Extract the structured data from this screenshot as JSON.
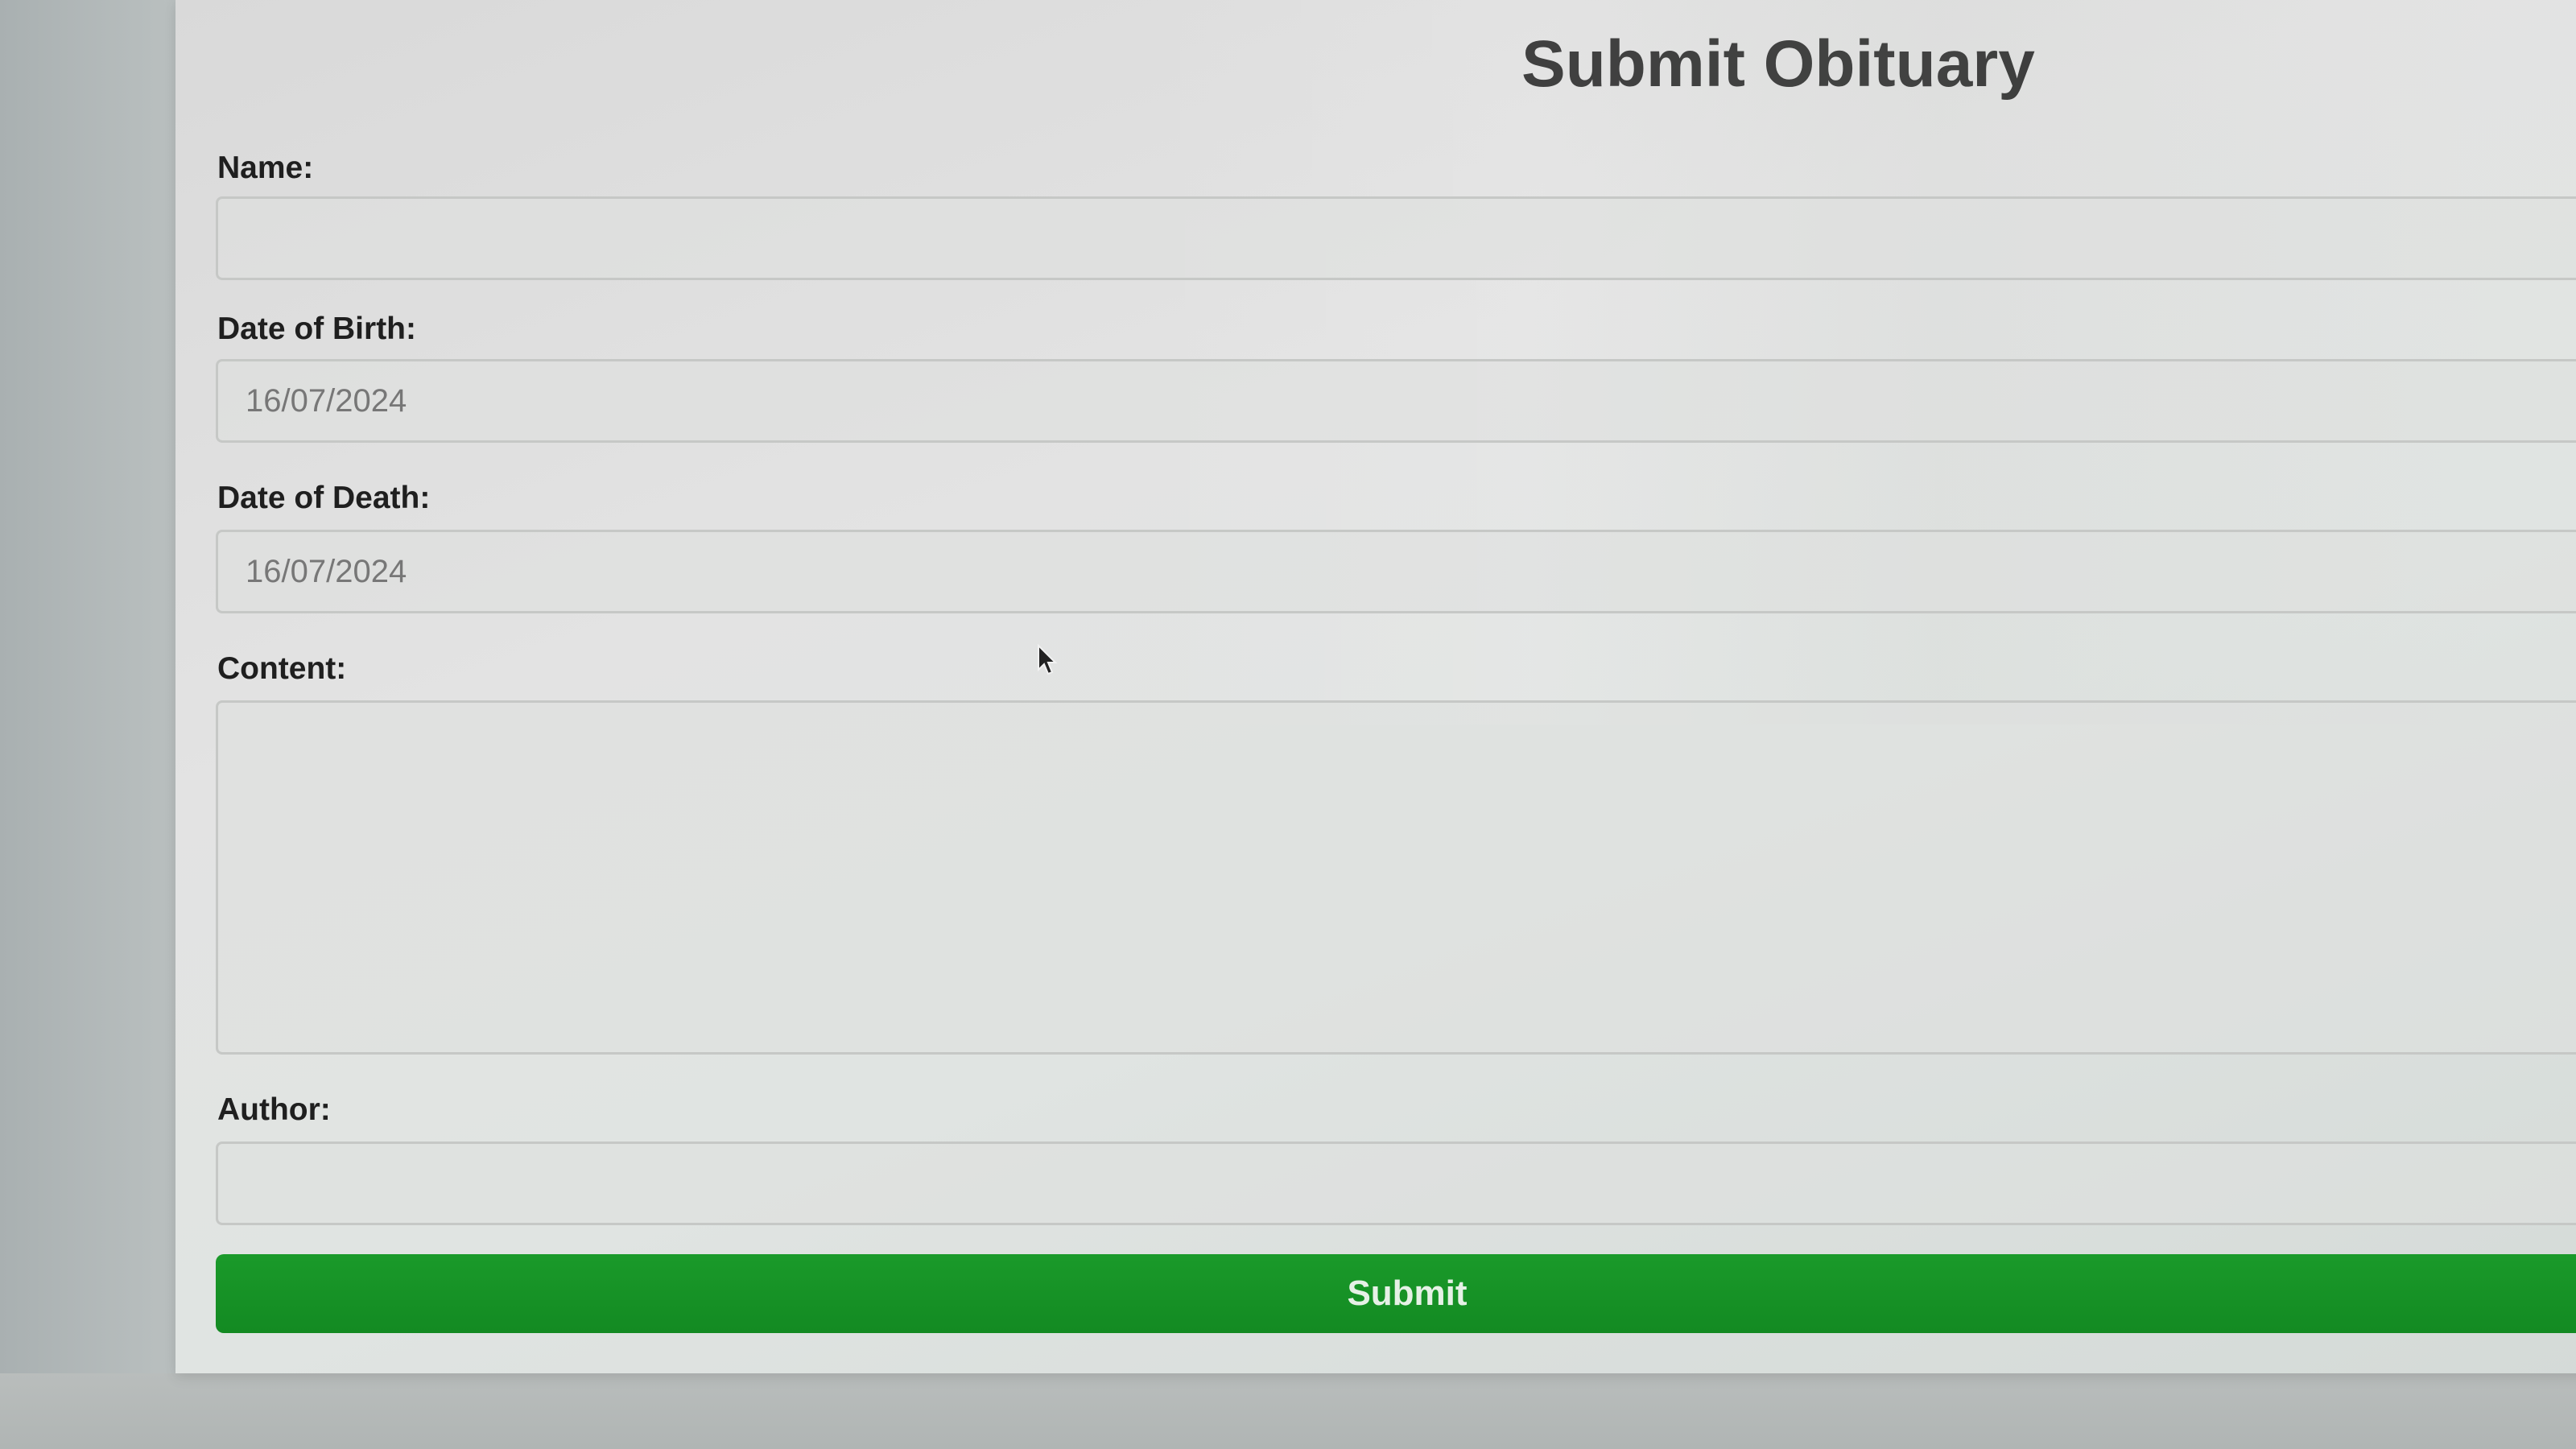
{
  "form": {
    "title": "Submit Obituary",
    "fields": {
      "name": {
        "label": "Name:",
        "value": ""
      },
      "date_of_birth": {
        "label": "Date of Birth:",
        "value": "16/07/2024"
      },
      "date_of_death": {
        "label": "Date of Death:",
        "value": "16/07/2024"
      },
      "content": {
        "label": "Content:",
        "value": ""
      },
      "author": {
        "label": "Author:",
        "value": ""
      }
    },
    "submit_label": "Submit"
  },
  "colors": {
    "submit_background": "#138a22",
    "title_text": "#2a2a2a",
    "field_border": "#c6c8c6"
  },
  "icons": {
    "cursor": "mouse-pointer-icon"
  }
}
